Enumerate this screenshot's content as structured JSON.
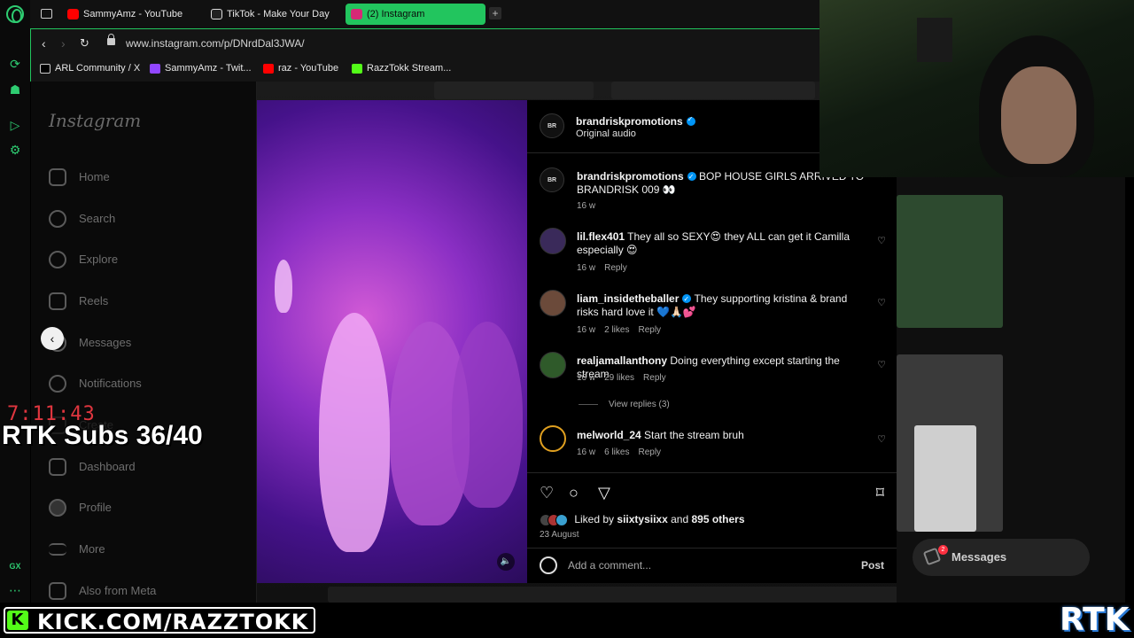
{
  "browser": {
    "tabs": [
      {
        "label": "SammyAmz - YouTube",
        "color": "#ff0000"
      },
      {
        "label": "TikTok - Make Your Day",
        "color": "#111111"
      },
      {
        "label": "(2) Instagram",
        "color": "#d62976"
      }
    ],
    "url": "www.instagram.com/p/DNrdDal3JWA/",
    "bookmarks": [
      {
        "label": "ARL Community / X",
        "color": "#000000"
      },
      {
        "label": "SammyAmz - Twit...",
        "color": "#9146ff"
      },
      {
        "label": "raz - YouTube",
        "color": "#ff0000"
      },
      {
        "label": "RazzTokk Stream...",
        "color": "#53fc18"
      }
    ],
    "gx_label": "GX"
  },
  "instagram": {
    "logo": "Instagram",
    "nav": [
      {
        "label": "Home",
        "icon": "home-icon"
      },
      {
        "label": "Search",
        "icon": "search-icon"
      },
      {
        "label": "Explore",
        "icon": "compass-icon"
      },
      {
        "label": "Reels",
        "icon": "reels-icon"
      },
      {
        "label": "Messages",
        "icon": "messages-icon"
      },
      {
        "label": "Notifications",
        "icon": "heart-icon"
      },
      {
        "label": "Create",
        "icon": "plus-icon"
      },
      {
        "label": "Dashboard",
        "icon": "dashboard-icon"
      },
      {
        "label": "Profile",
        "icon": "avatar"
      },
      {
        "label": "More",
        "icon": "menu-icon"
      },
      {
        "label": "Also from Meta",
        "icon": "meta-icon"
      }
    ],
    "post": {
      "author": "brandriskpromotions",
      "audio": "Original audio",
      "caption": {
        "user": "brandriskpromotions",
        "text": "BOP HOUSE GIRLS ARRIVED TO BRANDRISK 009 👀",
        "age": "16 w"
      },
      "comments": [
        {
          "user": "lil.flex401",
          "verified": false,
          "text": "They all so SEXY😍 they ALL can get it Camilla especially 😍",
          "age": "16 w",
          "likes": "",
          "reply": "Reply"
        },
        {
          "user": "liam_insidetheballer",
          "verified": true,
          "text": "They supporting kristina & brand risks hard love it 💙🙏🏻💕",
          "age": "16 w",
          "likes": "2 likes",
          "reply": "Reply"
        },
        {
          "user": "realjamallanthony",
          "verified": false,
          "text": "Doing everything except starting the stream",
          "age": "16 w",
          "likes": "29 likes",
          "reply": "Reply"
        },
        {
          "user": "melworld_24",
          "verified": false,
          "text": "Start the stream bruh",
          "age": "16 w",
          "likes": "6 likes",
          "reply": "Reply"
        }
      ],
      "view_replies": "View replies (3)",
      "liked_by_prefix": "Liked by",
      "liked_by_user": "siixtysiixx",
      "liked_by_and": "and",
      "liked_by_others": "895 others",
      "date": "23 August",
      "comment_placeholder": "Add a comment...",
      "post_label": "Post"
    },
    "messages_pill": "Messages",
    "messages_badge": "2"
  },
  "stream_overlay": {
    "timer": "7:11:43",
    "subs": "RTK Subs 36/40",
    "kick_url": "KICK.COM/RAZZTOKK",
    "logo": "RTK"
  }
}
